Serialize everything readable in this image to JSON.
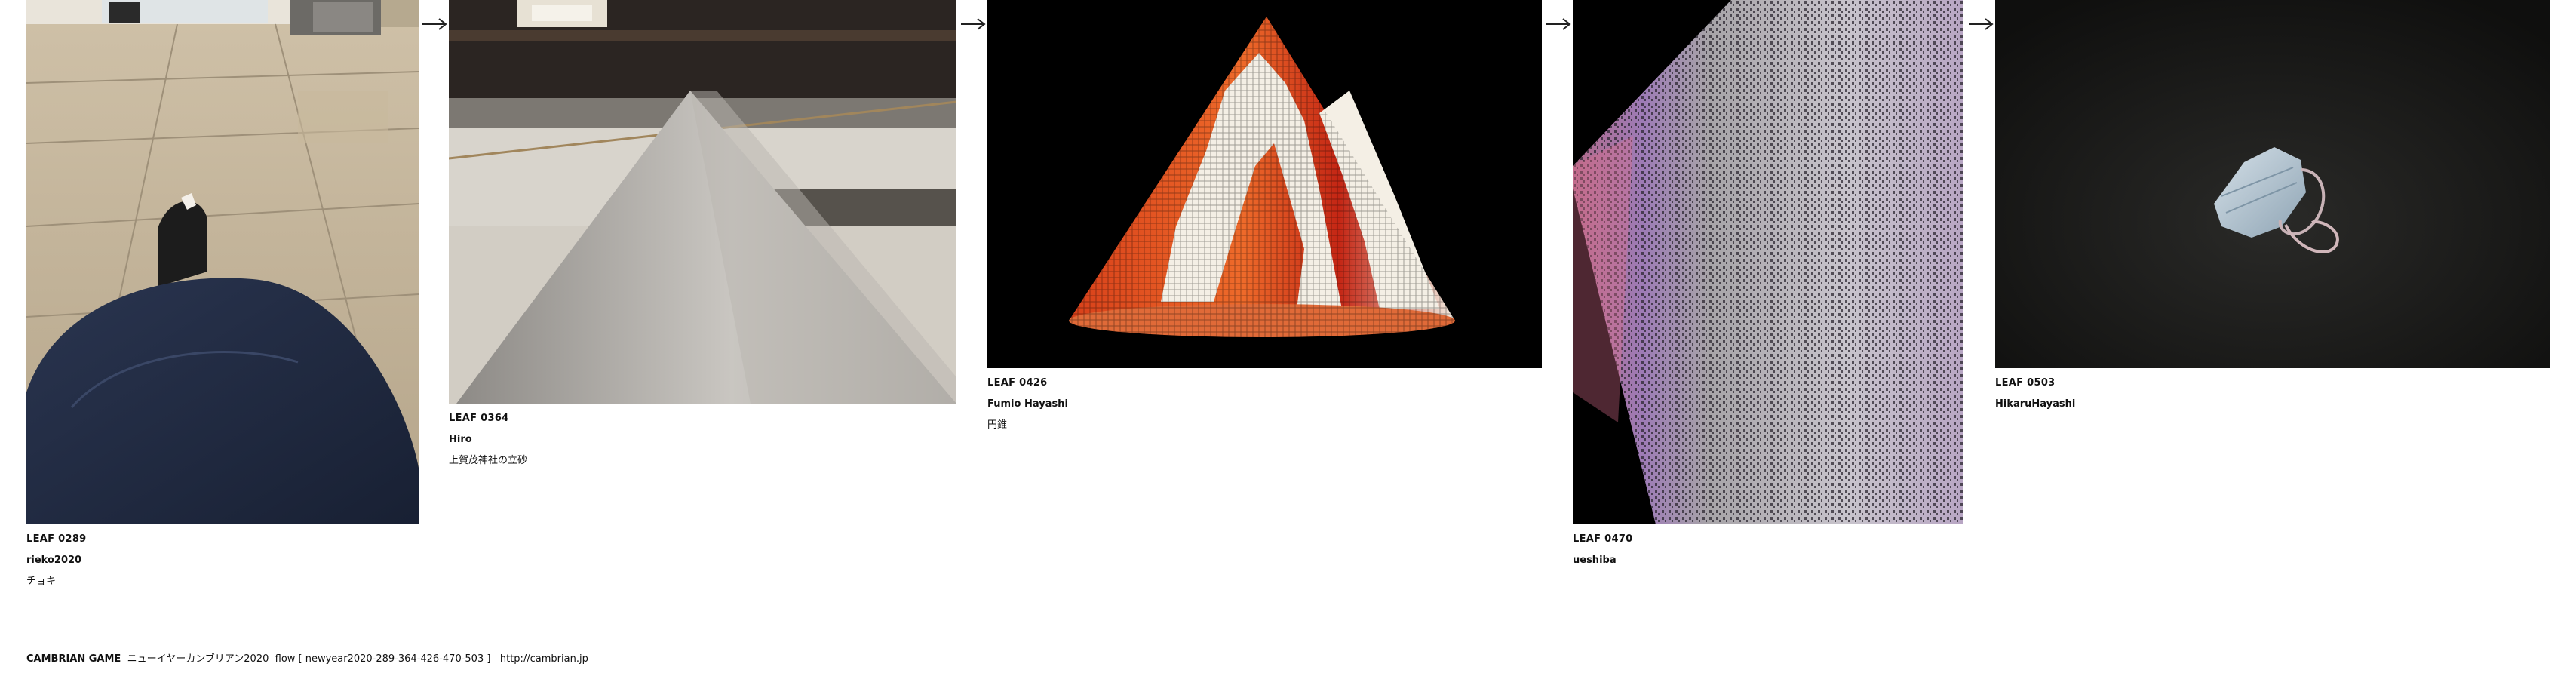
{
  "cards": [
    {
      "leaf": "LEAF 0289",
      "author": "rieko2020",
      "title": "チョキ"
    },
    {
      "leaf": "LEAF 0364",
      "author": "Hiro",
      "title": "上賀茂神社の立砂"
    },
    {
      "leaf": "LEAF 0426",
      "author": "Fumio Hayashi",
      "title": "円錐"
    },
    {
      "leaf": "LEAF 0470",
      "author": "ueshiba"
    },
    {
      "leaf": "LEAF 0503",
      "author": "HikaruHayashi"
    }
  ],
  "footer": {
    "game_name": "CAMBRIAN GAME",
    "flow_text": "ニューイヤーカンブリアン2020  flow [ newyear2020-289-364-426-470-503 ]",
    "url": "http://cambrian.jp"
  },
  "icons": {
    "connector": "arrow-right-icon"
  },
  "colors": {
    "text": "#111111",
    "background": "#ffffff"
  }
}
